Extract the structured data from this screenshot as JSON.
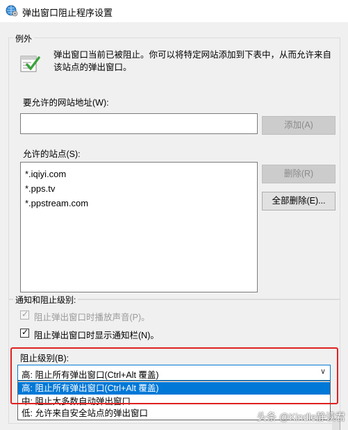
{
  "window": {
    "title": "弹出窗口阻止程序设置",
    "icon": "globe-gear-icon"
  },
  "exceptions": {
    "legend": "例外",
    "icon": "shield-check-icon",
    "description": "弹出窗口当前已被阻止。你可以将特定网站添加到下表中，从而允许来自该站点的弹出窗口。",
    "address_label": "要允许的网站地址(W):",
    "address_value": "",
    "add_button": "添加(A)",
    "allowed_label": "允许的站点(S):",
    "allowed_sites": [
      "*.iqiyi.com",
      "*.pps.tv",
      "*.ppstream.com"
    ],
    "remove_button": "删除(R)",
    "remove_all_button": "全部删除(E)..."
  },
  "notify": {
    "legend": "通知和阻止级别:",
    "play_sound_label": "阻止弹出窗口时播放声音(P)。",
    "play_sound_checked": true,
    "play_sound_disabled": true,
    "show_bar_label": "阻止弹出窗口时显示通知栏(N)。",
    "show_bar_checked": true,
    "level_label": "阻止级别(B):",
    "level_value": "高: 阻止所有弹出窗口(Ctrl+Alt 覆盖)",
    "level_options": [
      "高: 阻止所有弹出窗口(Ctrl+Alt 覆盖)",
      "中: 阻止大多数自动弹出窗口",
      "低: 允许来自安全站点的弹出窗口"
    ],
    "selected_option": 0
  },
  "watermark": "头条 @Kindle静读君",
  "colors": {
    "highlight": "#0078d7",
    "annotation_box": "#e02020"
  }
}
